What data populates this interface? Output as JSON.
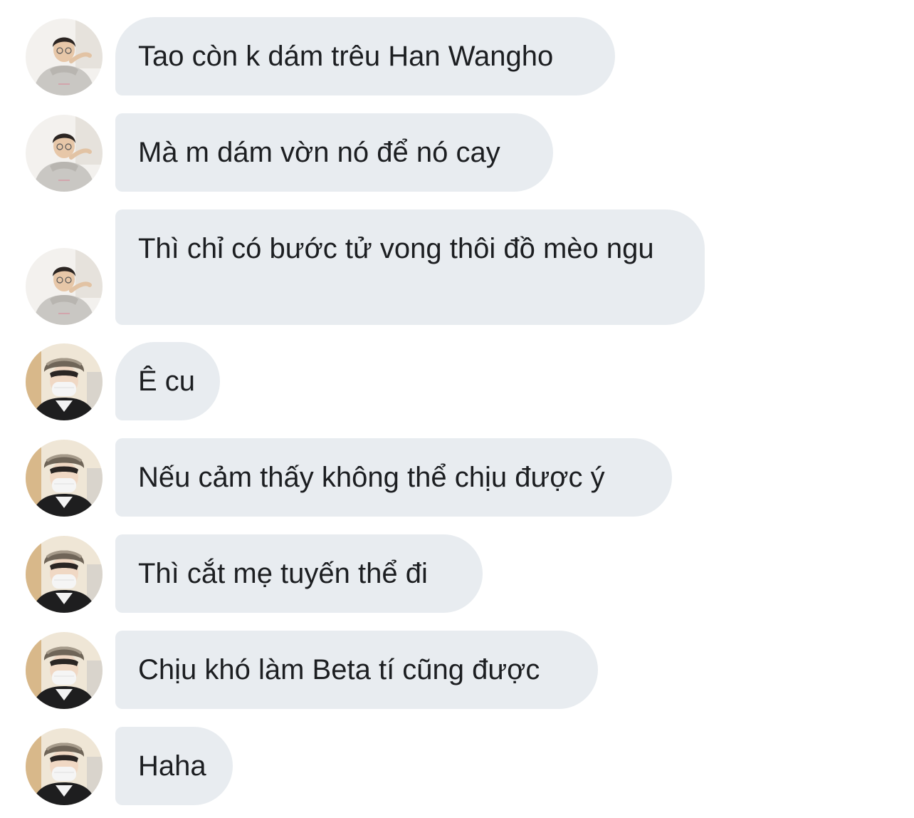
{
  "conversation": {
    "messages": [
      {
        "sender_avatar": "person-in-grey-hoodie-avatar",
        "text": "Tao còn k dám trêu Han Wangho"
      },
      {
        "sender_avatar": "person-in-grey-hoodie-avatar",
        "text": "Mà m dám vờn nó để nó cay"
      },
      {
        "sender_avatar": "person-in-grey-hoodie-avatar",
        "text": "Thì chỉ có bước tử vong thôi đồ mèo ngu"
      },
      {
        "sender_avatar": "person-in-fur-hat-mask-avatar",
        "text": "Ê cu"
      },
      {
        "sender_avatar": "person-in-fur-hat-mask-avatar",
        "text": "Nếu cảm thấy không thể chịu được ý"
      },
      {
        "sender_avatar": "person-in-fur-hat-mask-avatar",
        "text": "Thì cắt mẹ tuyến thể đi"
      },
      {
        "sender_avatar": "person-in-fur-hat-mask-avatar",
        "text": "Chịu khó làm Beta tí cũng được"
      },
      {
        "sender_avatar": "person-in-fur-hat-mask-avatar",
        "text": "Haha"
      }
    ]
  },
  "colors": {
    "bubble_background": "#e8ecf0",
    "text": "#1c1e21",
    "page_background": "#ffffff"
  }
}
